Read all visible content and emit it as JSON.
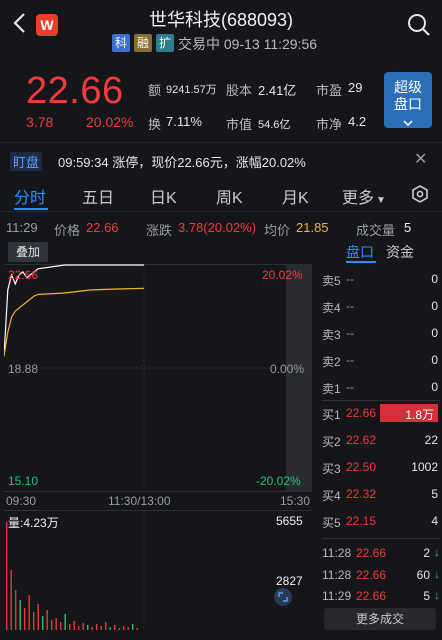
{
  "header": {
    "title": "世华科技(688093)",
    "logo_letter": "W",
    "tags": [
      "科",
      "融",
      "扩"
    ],
    "trade_status": "交易中 09-13 11:29:56"
  },
  "quote": {
    "price": "22.66",
    "change": "3.78",
    "change_pct": "20.02%",
    "amount_label": "额",
    "amount_value": "9241.57万",
    "capital_label": "股本",
    "capital_value": "2.41亿",
    "pe_label": "市盈",
    "pe_value": "29",
    "turnover_label": "换",
    "turnover_value": "7.11%",
    "mktcap_label": "市值",
    "mktcap_value": "54.6亿",
    "pb_label": "市净",
    "pb_value": "4.2",
    "super_btn_line1": "超级",
    "super_btn_line2": "盘口"
  },
  "alert": {
    "tag": "盯盘",
    "text": "09:59:34 涨停，现价22.66元，涨幅20.02%"
  },
  "period_tabs": [
    "分时",
    "五日",
    "日K",
    "周K",
    "月K",
    "更多"
  ],
  "info_row": {
    "time": "11:29",
    "price_label": "价格",
    "price_value": "22.66",
    "chg_label": "涨跌",
    "chg_value": "3.78(20.02%)",
    "avg_label": "均价",
    "avg_value": "21.85",
    "vol_label": "成交量",
    "vol_value": "5"
  },
  "overlay_btn": "叠加",
  "chart": {
    "top_price": "22.66",
    "mid_price": "18.88",
    "bottom_price": "15.10",
    "top_pct": "20.02%",
    "mid_pct": "0.00%",
    "bottom_pct": "-20.02%",
    "x_start": "09:30",
    "x_mid": "11:30/13:00",
    "x_end": "15:30",
    "vol_label": "量:4.23万",
    "vol_max": "5655",
    "vol_mid": "2827",
    "price_color": "#ffffff",
    "avg_color": "#f2b134"
  },
  "order_book": {
    "tabs": [
      "盘口",
      "资金"
    ],
    "asks": [
      {
        "label": "卖5",
        "price": "--",
        "vol": "0"
      },
      {
        "label": "卖4",
        "price": "--",
        "vol": "0"
      },
      {
        "label": "卖3",
        "price": "--",
        "vol": "0"
      },
      {
        "label": "卖2",
        "price": "--",
        "vol": "0"
      },
      {
        "label": "卖1",
        "price": "--",
        "vol": "0"
      }
    ],
    "bids": [
      {
        "label": "买1",
        "price": "22.66",
        "vol": "1.8万"
      },
      {
        "label": "买2",
        "price": "22.62",
        "vol": "22"
      },
      {
        "label": "买3",
        "price": "22.50",
        "vol": "1002"
      },
      {
        "label": "买4",
        "price": "22.32",
        "vol": "5"
      },
      {
        "label": "买5",
        "price": "22.15",
        "vol": "4"
      }
    ],
    "ticks": [
      {
        "time": "11:28",
        "price": "22.66",
        "vol": "2",
        "dir": "↓"
      },
      {
        "time": "11:28",
        "price": "22.66",
        "vol": "60",
        "dir": "↓"
      },
      {
        "time": "11:29",
        "price": "22.66",
        "vol": "5",
        "dir": "↓"
      }
    ],
    "more_label": "更多成交"
  },
  "chart_data": {
    "type": "line",
    "x": [
      "09:30",
      "09:31",
      "09:32",
      "09:34",
      "09:36",
      "09:38",
      "09:40",
      "09:45",
      "09:50",
      "09:55",
      "09:59",
      "10:30",
      "11:00",
      "11:29"
    ],
    "series": [
      {
        "values": [
          19.6,
          21.8,
          22.3,
          22.0,
          22.3,
          22.4,
          22.2,
          22.3,
          22.4,
          22.5,
          22.66,
          22.66,
          22.66,
          22.66
        ]
      },
      {
        "values": [
          19.6,
          20.4,
          20.9,
          21.1,
          21.2,
          21.3,
          21.4,
          21.5,
          21.6,
          21.65,
          21.7,
          21.8,
          21.83,
          21.85
        ]
      }
    ],
    "ylim": [
      15.1,
      22.66
    ]
  }
}
